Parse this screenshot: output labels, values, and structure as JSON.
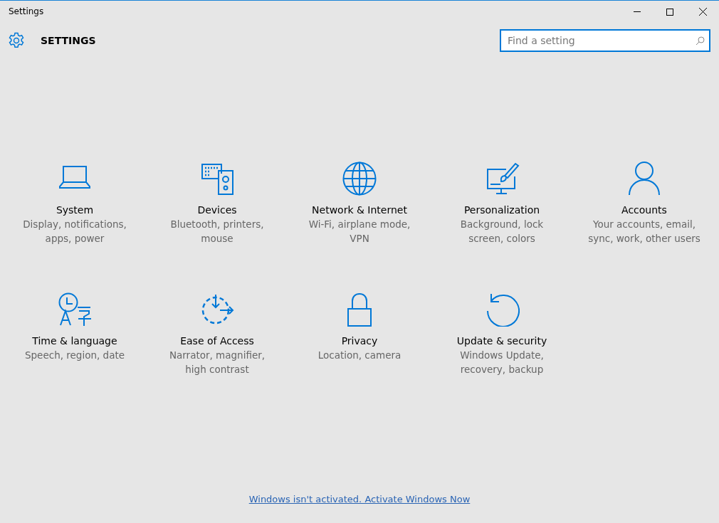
{
  "window": {
    "title": "Settings"
  },
  "header": {
    "title": "SETTINGS"
  },
  "search": {
    "placeholder": "Find a setting"
  },
  "tiles": [
    {
      "title": "System",
      "description": "Display, notifications, apps, power"
    },
    {
      "title": "Devices",
      "description": "Bluetooth, printers, mouse"
    },
    {
      "title": "Network & Internet",
      "description": "Wi-Fi, airplane mode, VPN"
    },
    {
      "title": "Personalization",
      "description": "Background, lock screen, colors"
    },
    {
      "title": "Accounts",
      "description": "Your accounts, email, sync, work, other users"
    },
    {
      "title": "Time & language",
      "description": "Speech, region, date"
    },
    {
      "title": "Ease of Access",
      "description": "Narrator, magnifier, high contrast"
    },
    {
      "title": "Privacy",
      "description": "Location, camera"
    },
    {
      "title": "Update & security",
      "description": "Windows Update, recovery, backup"
    }
  ],
  "footer_link": "Windows isn't activated. Activate Windows Now"
}
